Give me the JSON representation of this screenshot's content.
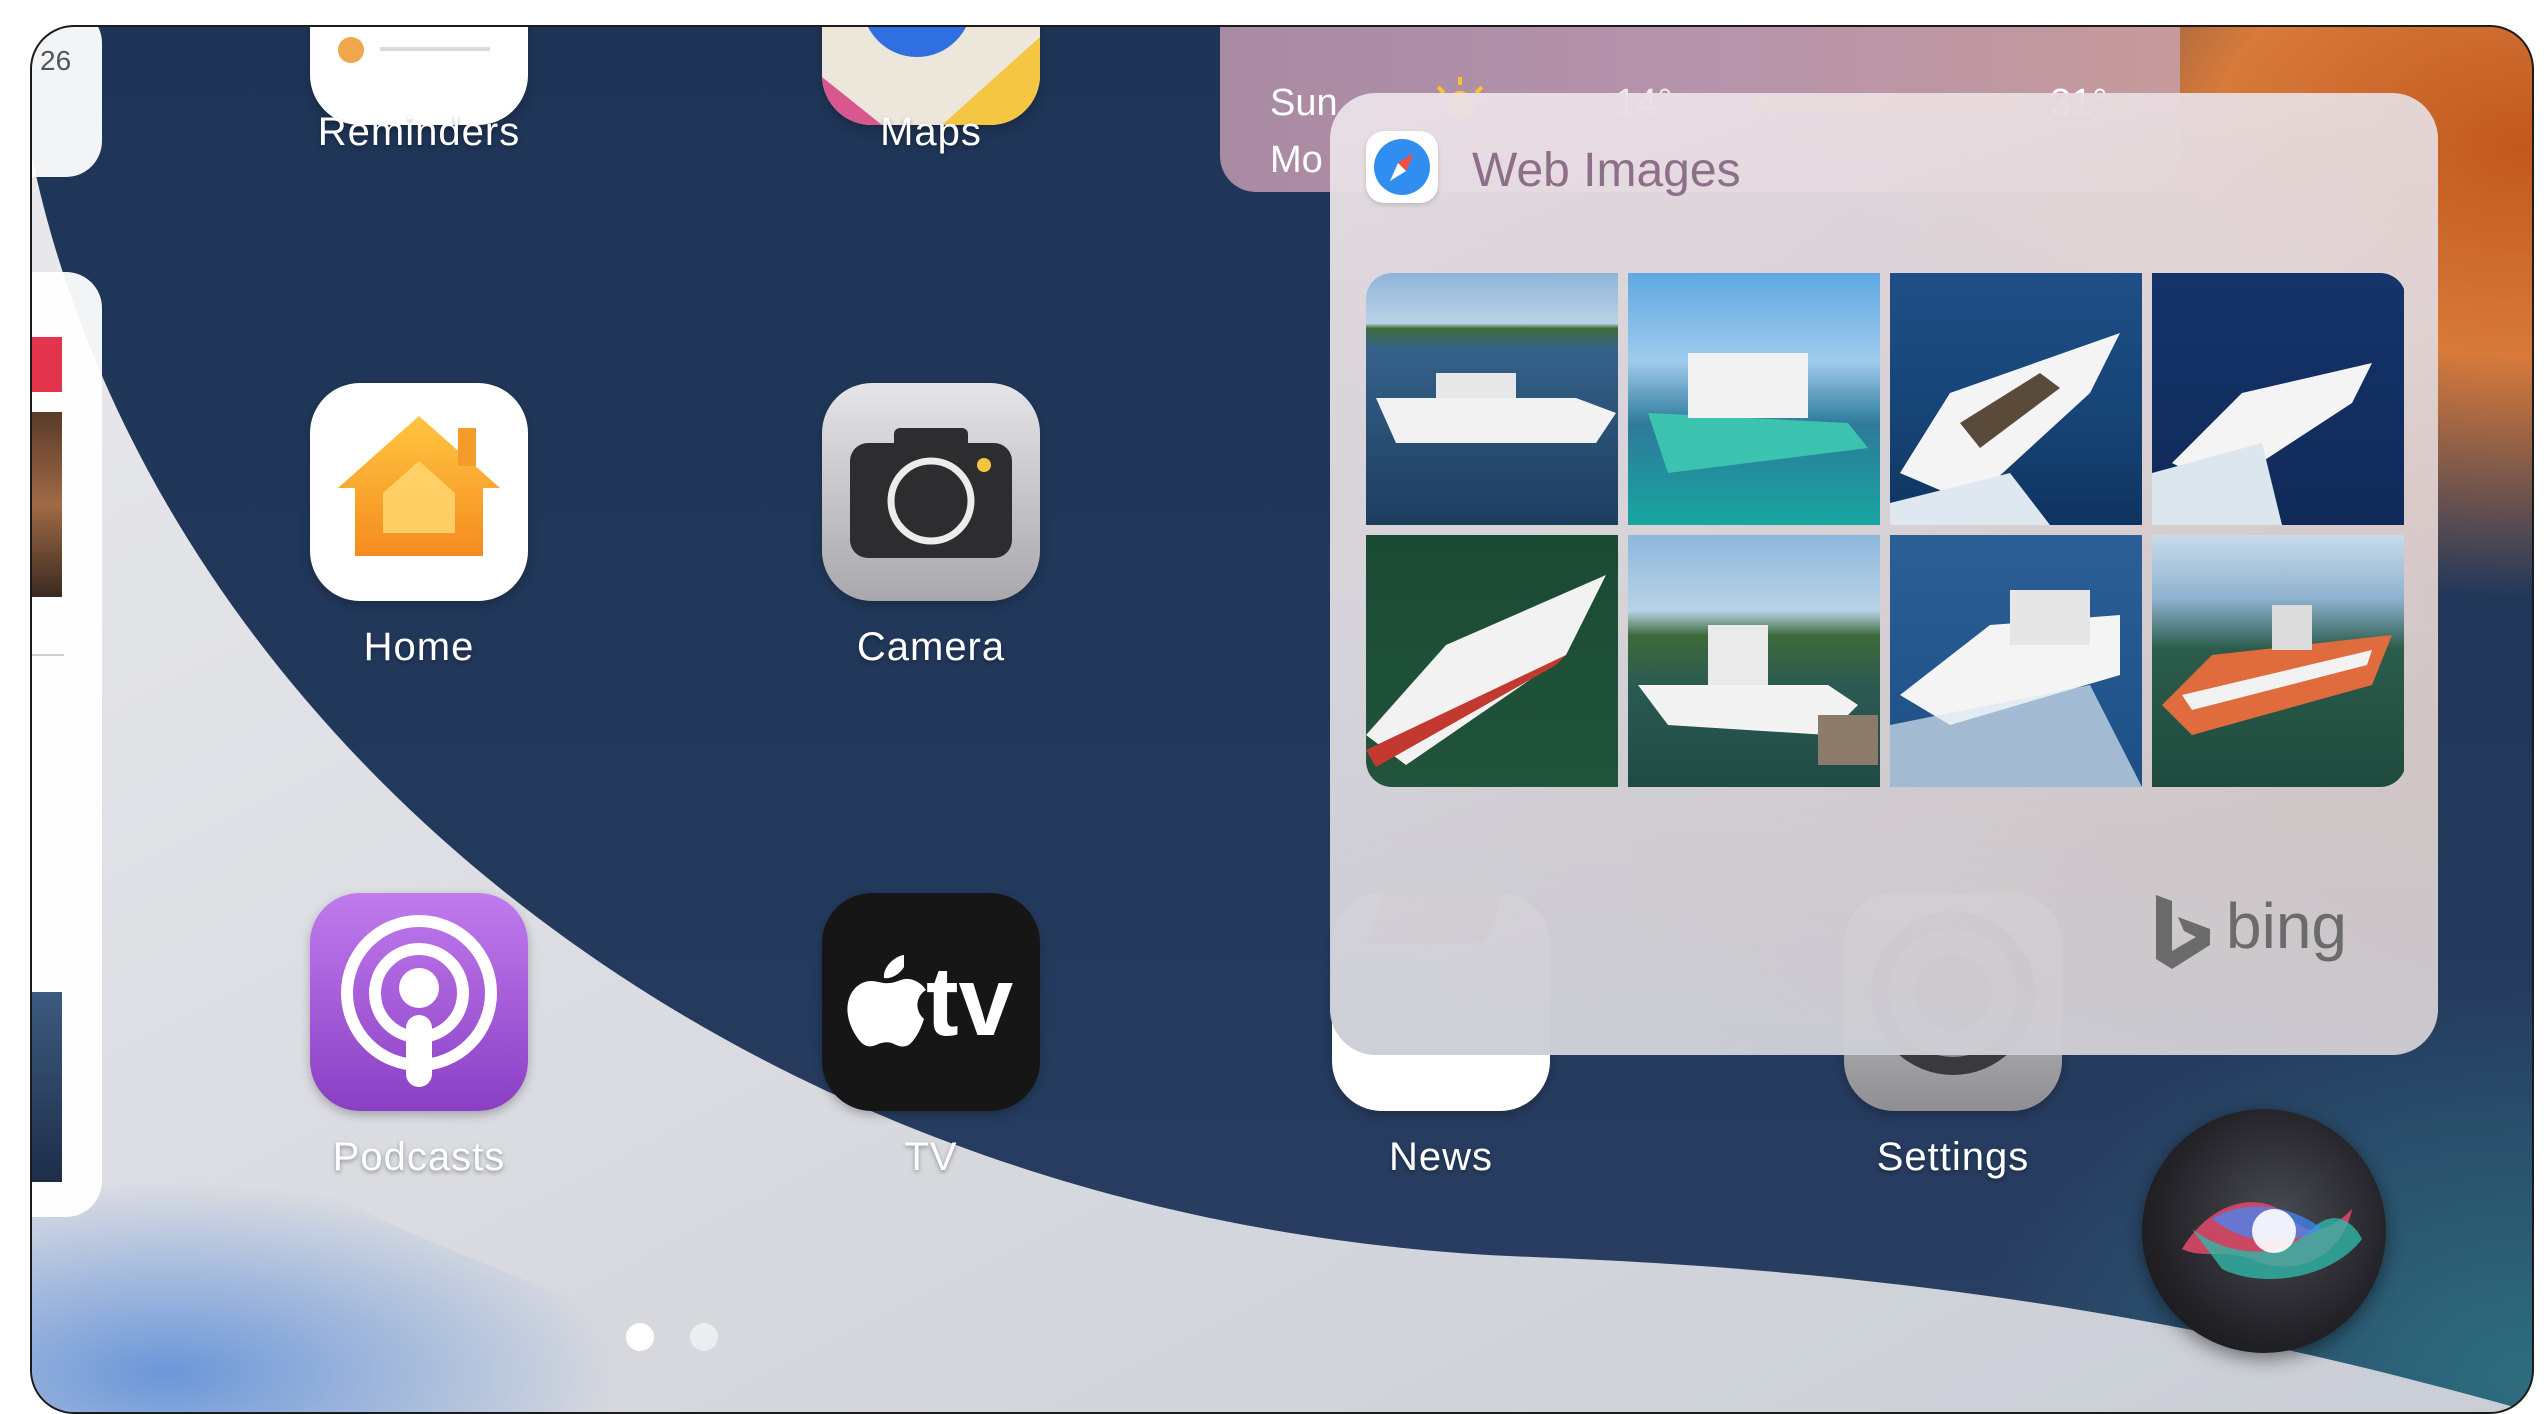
{
  "left_card": {
    "text": "26"
  },
  "apps": [
    {
      "label": "Reminders"
    },
    {
      "label": "Maps"
    },
    {
      "label": "Home"
    },
    {
      "label": "Camera"
    },
    {
      "label": "Podcasts"
    },
    {
      "label": "TV"
    },
    {
      "label": "News"
    },
    {
      "label": "Settings"
    }
  ],
  "tv_icon_text": "tv",
  "weather": {
    "rows": [
      {
        "day": "Sun",
        "low": "14°",
        "high": "31°"
      },
      {
        "day": "Mo",
        "low": "",
        "high": ""
      }
    ]
  },
  "siri_panel": {
    "title": "Web Images",
    "provider": "bing",
    "images": [
      {
        "subject": "white boat on lake"
      },
      {
        "subject": "teal hull yacht"
      },
      {
        "subject": "white cruiser on dark water"
      },
      {
        "subject": "white cruiser at speed"
      },
      {
        "subject": "speedboat with red stripe"
      },
      {
        "subject": "fishing boat at dock"
      },
      {
        "subject": "motor yacht in waves"
      },
      {
        "subject": "orange fishing boat"
      }
    ]
  },
  "page_dots": {
    "count": 2,
    "active": 1
  },
  "colors": {
    "accent_orange": "#f0a64a",
    "podcasts_purple": "#a45fd5",
    "news_red": "#e2344b",
    "bing_gray": "#6b6b6b"
  }
}
